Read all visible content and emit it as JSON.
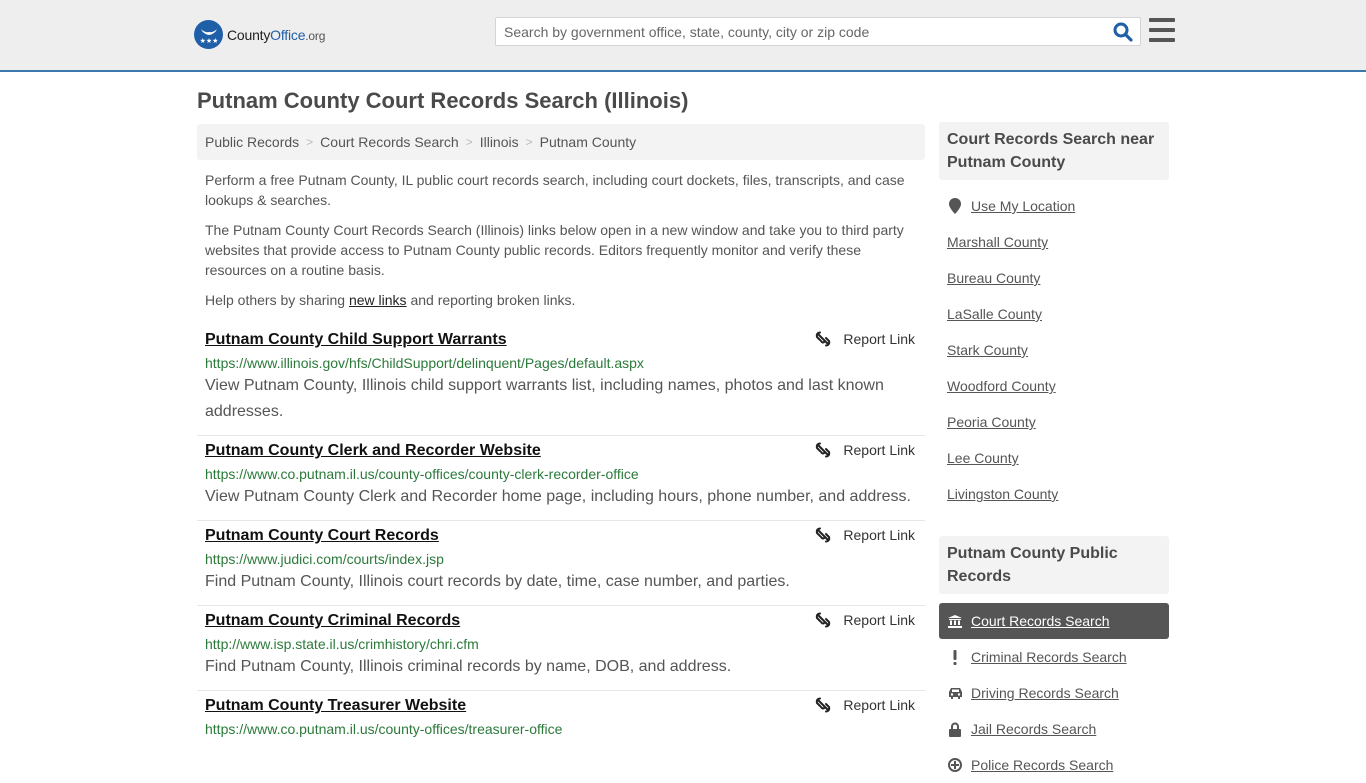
{
  "header": {
    "logo": {
      "prefix": "County",
      "brand": "Office",
      "tld": ".org",
      "icon": "eagle-stars-icon"
    },
    "search": {
      "placeholder": "Search by government office, state, county, city or zip code",
      "value": "",
      "icon": "search-icon"
    },
    "menu_icon": "hamburger-menu-icon"
  },
  "page": {
    "title": "Putnam County Court Records Search (Illinois)",
    "breadcrumb": [
      "Public Records",
      "Court Records Search",
      "Illinois",
      "Putnam County"
    ],
    "breadcrumb_separator": ">",
    "intro": {
      "p1": "Perform a free Putnam County, IL public court records search, including court dockets, files, transcripts, and case lookups & searches.",
      "p2": "The Putnam County Court Records Search (Illinois) links below open in a new window and take you to third party websites that provide access to Putnam County public records. Editors frequently monitor and verify these resources on a routine basis.",
      "p3_before": "Help others by sharing ",
      "p3_link": "new links",
      "p3_after": " and reporting broken links."
    }
  },
  "results": [
    {
      "title": "Putnam County Child Support Warrants",
      "url": "https://www.illinois.gov/hfs/ChildSupport/delinquent/Pages/default.aspx",
      "description": "View Putnam County, Illinois child support warrants list, including names, photos and last known addresses.",
      "report_label": "Report Link"
    },
    {
      "title": "Putnam County Clerk and Recorder Website",
      "url": "https://www.co.putnam.il.us/county-offices/county-clerk-recorder-office",
      "description": "View Putnam County Clerk and Recorder home page, including hours, phone number, and address.",
      "report_label": "Report Link"
    },
    {
      "title": "Putnam County Court Records",
      "url": "https://www.judici.com/courts/index.jsp",
      "description": "Find Putnam County, Illinois court records by date, time, case number, and parties.",
      "report_label": "Report Link"
    },
    {
      "title": "Putnam County Criminal Records",
      "url": "http://www.isp.state.il.us/crimhistory/chri.cfm",
      "description": "Find Putnam County, Illinois criminal records by name, DOB, and address.",
      "report_label": "Report Link"
    },
    {
      "title": "Putnam County Treasurer Website",
      "url": "https://www.co.putnam.il.us/county-offices/treasurer-office",
      "description": "",
      "report_label": "Report Link"
    }
  ],
  "sidebar": {
    "nearby": {
      "heading": "Court Records Search near Putnam County",
      "use_location": "Use My Location",
      "counties": [
        "Marshall County",
        "Bureau County",
        "LaSalle County",
        "Stark County",
        "Woodford County",
        "Peoria County",
        "Lee County",
        "Livingston County"
      ]
    },
    "public_records": {
      "heading": "Putnam County Public Records",
      "items": [
        {
          "label": "Court Records Search",
          "icon": "courthouse-icon",
          "active": true
        },
        {
          "label": "Criminal Records Search",
          "icon": "exclamation-icon",
          "active": false
        },
        {
          "label": "Driving Records Search",
          "icon": "car-icon",
          "active": false
        },
        {
          "label": "Jail Records Search",
          "icon": "lock-icon",
          "active": false
        },
        {
          "label": "Police Records Search",
          "icon": "police-badge-icon",
          "active": false
        }
      ]
    }
  },
  "colors": {
    "accent": "#3a78ad",
    "brand": "#1f5fa8",
    "url_green": "#2b7a3a",
    "active_item_bg": "#555555"
  }
}
